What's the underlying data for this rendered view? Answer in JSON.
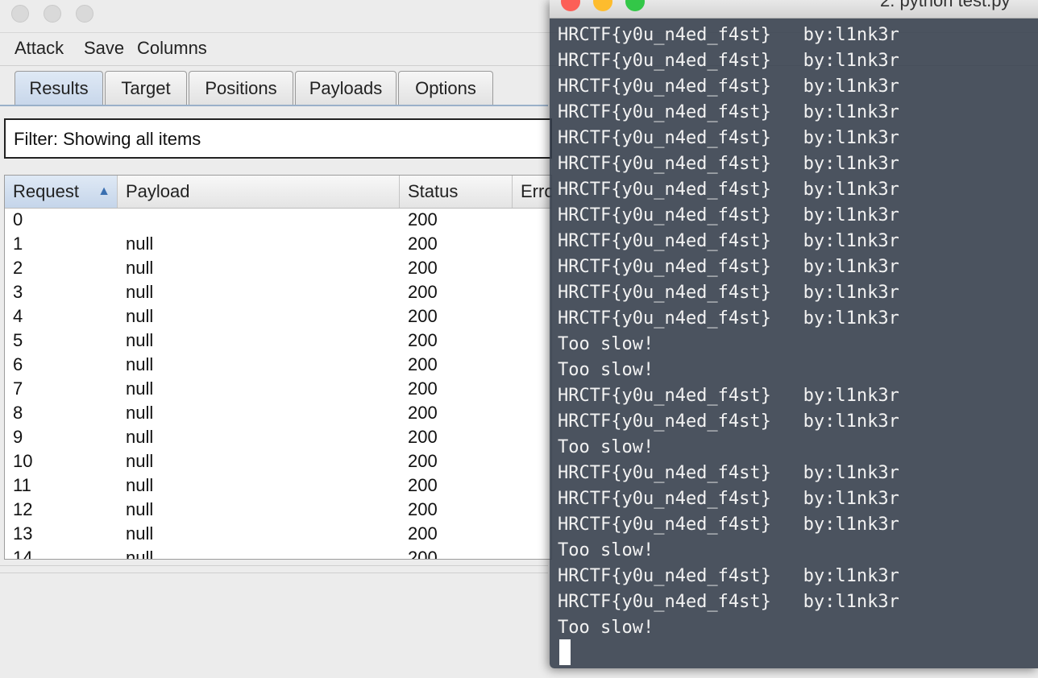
{
  "burp": {
    "menu": [
      "Attack",
      "Save",
      "Columns"
    ],
    "tabs": [
      {
        "label": "Results",
        "active": true
      },
      {
        "label": "Target",
        "active": false
      },
      {
        "label": "Positions",
        "active": false
      },
      {
        "label": "Payloads",
        "active": false
      },
      {
        "label": "Options",
        "active": false
      }
    ],
    "filter_text": "Filter: Showing all items",
    "columns": [
      "Request",
      "Payload",
      "Status",
      "Erro"
    ],
    "rows": [
      {
        "request": "0",
        "payload": "",
        "status": "200"
      },
      {
        "request": "1",
        "payload": "null",
        "status": "200"
      },
      {
        "request": "2",
        "payload": "null",
        "status": "200"
      },
      {
        "request": "3",
        "payload": "null",
        "status": "200"
      },
      {
        "request": "4",
        "payload": "null",
        "status": "200"
      },
      {
        "request": "5",
        "payload": "null",
        "status": "200"
      },
      {
        "request": "6",
        "payload": "null",
        "status": "200"
      },
      {
        "request": "7",
        "payload": "null",
        "status": "200"
      },
      {
        "request": "8",
        "payload": "null",
        "status": "200"
      },
      {
        "request": "9",
        "payload": "null",
        "status": "200"
      },
      {
        "request": "10",
        "payload": "null",
        "status": "200"
      },
      {
        "request": "11",
        "payload": "null",
        "status": "200"
      },
      {
        "request": "12",
        "payload": "null",
        "status": "200"
      },
      {
        "request": "13",
        "payload": "null",
        "status": "200"
      },
      {
        "request": "14",
        "payload": "null",
        "status": "200"
      }
    ]
  },
  "terminal": {
    "title": "2. python test.py",
    "lines": [
      "HRCTF{y0u_n4ed_f4st}   by:l1nk3r",
      "HRCTF{y0u_n4ed_f4st}   by:l1nk3r",
      "HRCTF{y0u_n4ed_f4st}   by:l1nk3r",
      "HRCTF{y0u_n4ed_f4st}   by:l1nk3r",
      "HRCTF{y0u_n4ed_f4st}   by:l1nk3r",
      "HRCTF{y0u_n4ed_f4st}   by:l1nk3r",
      "HRCTF{y0u_n4ed_f4st}   by:l1nk3r",
      "HRCTF{y0u_n4ed_f4st}   by:l1nk3r",
      "HRCTF{y0u_n4ed_f4st}   by:l1nk3r",
      "HRCTF{y0u_n4ed_f4st}   by:l1nk3r",
      "HRCTF{y0u_n4ed_f4st}   by:l1nk3r",
      "HRCTF{y0u_n4ed_f4st}   by:l1nk3r",
      "Too slow!",
      "Too slow!",
      "HRCTF{y0u_n4ed_f4st}   by:l1nk3r",
      "HRCTF{y0u_n4ed_f4st}   by:l1nk3r",
      "Too slow!",
      "HRCTF{y0u_n4ed_f4st}   by:l1nk3r",
      "HRCTF{y0u_n4ed_f4st}   by:l1nk3r",
      "HRCTF{y0u_n4ed_f4st}   by:l1nk3r",
      "Too slow!",
      "HRCTF{y0u_n4ed_f4st}   by:l1nk3r",
      "HRCTF{y0u_n4ed_f4st}   by:l1nk3r",
      "Too slow!"
    ],
    "colors": {
      "close": "#fc5f57",
      "minimize": "#fdbc2e",
      "zoom": "#33c748"
    }
  }
}
